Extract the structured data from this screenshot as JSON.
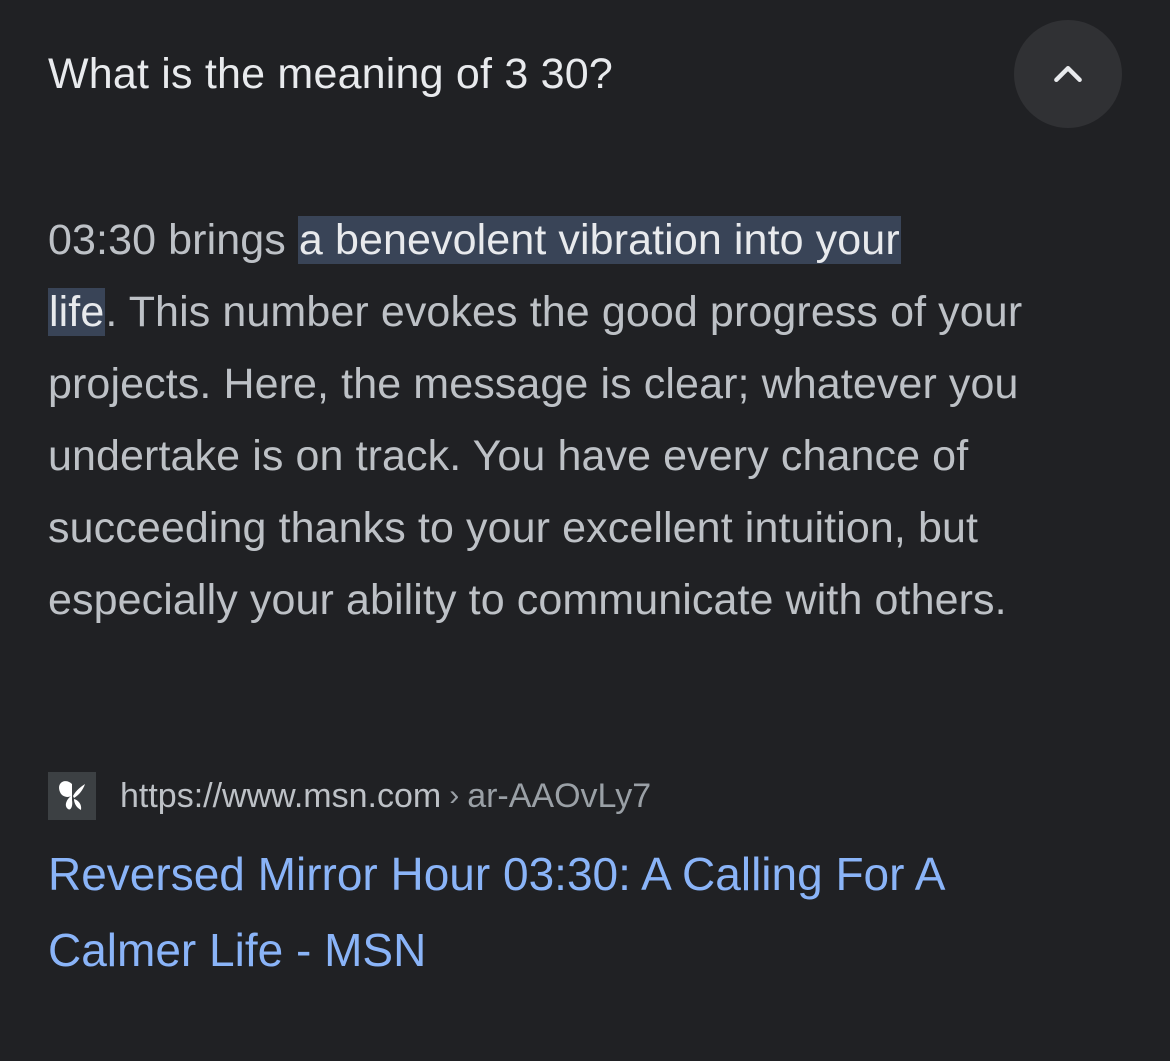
{
  "question": {
    "title": "What is the meaning of 3 30?",
    "collapse_icon": "chevron-up-icon"
  },
  "answer": {
    "prefix": "03:30 brings ",
    "highlight_1": "a benevolent vibration into your",
    "highlight_2": "life",
    "suffix": ". This number evokes the good progress of your projects. Here, the message is clear; whatever you undertake is on track. You have every chance of succeeding thanks to your excellent intuition, but especially your ability to communicate with others.",
    "highlight_color": "#394457"
  },
  "source": {
    "favicon": "msn-butterfly-icon",
    "url": "https://www.msn.com",
    "separator": "›",
    "path": "ar-AAOvLy7"
  },
  "result": {
    "title": "Reversed Mirror Hour 03:30: A Calling For A Calmer Life - MSN",
    "link_color": "#8ab4f8"
  }
}
